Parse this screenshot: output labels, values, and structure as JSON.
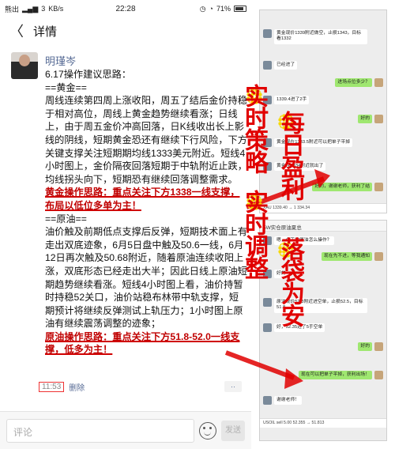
{
  "status_bar": {
    "carrier": "熊出",
    "signal": "3",
    "speed": "KB/s",
    "time": "22:28",
    "battery": "71%"
  },
  "nav": {
    "back_icon": "chevron-left-icon",
    "title": "详情"
  },
  "post": {
    "author": "明瑾岑",
    "paragraphs": [
      "6.17操作建议思路：",
      "==黄金==",
      "周线连续第四周上涨收阳，周五了结后金价持稳于相对高位，周线上黄金趋势继续看涨；日线上，由于周五金价冲高回落，日K线收出长上影线的阴线，短期黄金恐还有继续下行风险，下方关键支撑关注短期期均线1333美元附近。短线4小时图上，金价隔夜回落短期于中轨附近止跌，均线拐头向下，短期恐有继续回落调整需求。",
      "黄金操作思路：重点关注下方1338一线支撑，布局以低位多单为主！",
      "==原油==",
      "油价触及前期低点支撑后反弹，短期技术面上有走出双底迹象，6月5日盘中触及50.6一线，6月12日再次触及50.68附近，随着原油连续收阳上涨，双底形态已经走出大半；因此日线上原油短期趋势继续看涨。短线4小时图上看，油价持暂时持稳52关口，油价站稳布林带中轨支撑，短期预计将继续反弹测试上轨压力；1小时图上原油有继续震荡调整的迹象；",
      "原油操作思路：重点关注下方51.8-52.0一线支撑，低多为主！"
    ],
    "time": "11:53",
    "delete_label": "删除",
    "more_label": "··"
  },
  "comment_bar": {
    "placeholder": "评论",
    "send_label": "发送"
  },
  "annotations": {
    "vertical_1": "实时策略",
    "vertical_2": "每日盈利",
    "vertical_3": "实时调整",
    "vertical_4": "落袋为安"
  },
  "chat1": {
    "messages": [
      {
        "side": "left",
        "text": "黄金现价1339附近做空，止损1343，目标看1332"
      },
      {
        "side": "left",
        "text": "已经进了"
      },
      {
        "side": "right",
        "text": "进场点位多少？"
      },
      {
        "side": "left",
        "text": "1339.4进了2手"
      },
      {
        "side": "right",
        "text": "好的"
      },
      {
        "side": "left",
        "text": "黄金现在1333.5附近可以把单子平掉"
      },
      {
        "side": "left",
        "text": "黄金在1334附近就出了"
      },
      {
        "side": "right",
        "text": "好的，谢谢老师，获利了结"
      }
    ],
    "quote": "XAU 1339.40 → 1 334.34"
  },
  "chat2": {
    "header": "5W实仓原油夏总",
    "messages": [
      {
        "side": "left",
        "text": "嗯，今天的原油怎么操作？"
      },
      {
        "side": "right",
        "text": "现在先不进，等我通知"
      },
      {
        "side": "left",
        "text": "好的"
      },
      {
        "side": "left",
        "text": "原油现价52.3附近进空单，止损52.5，目标51.8"
      },
      {
        "side": "left",
        "text": "好，52.35进了5手空单"
      },
      {
        "side": "right",
        "text": "好的"
      },
      {
        "side": "right",
        "text": "现在可以把单子平掉，获利出场！"
      },
      {
        "side": "left",
        "text": "谢谢老师！"
      }
    ],
    "quote": "USOIL sell 5.00 52.355 → 51.813"
  }
}
